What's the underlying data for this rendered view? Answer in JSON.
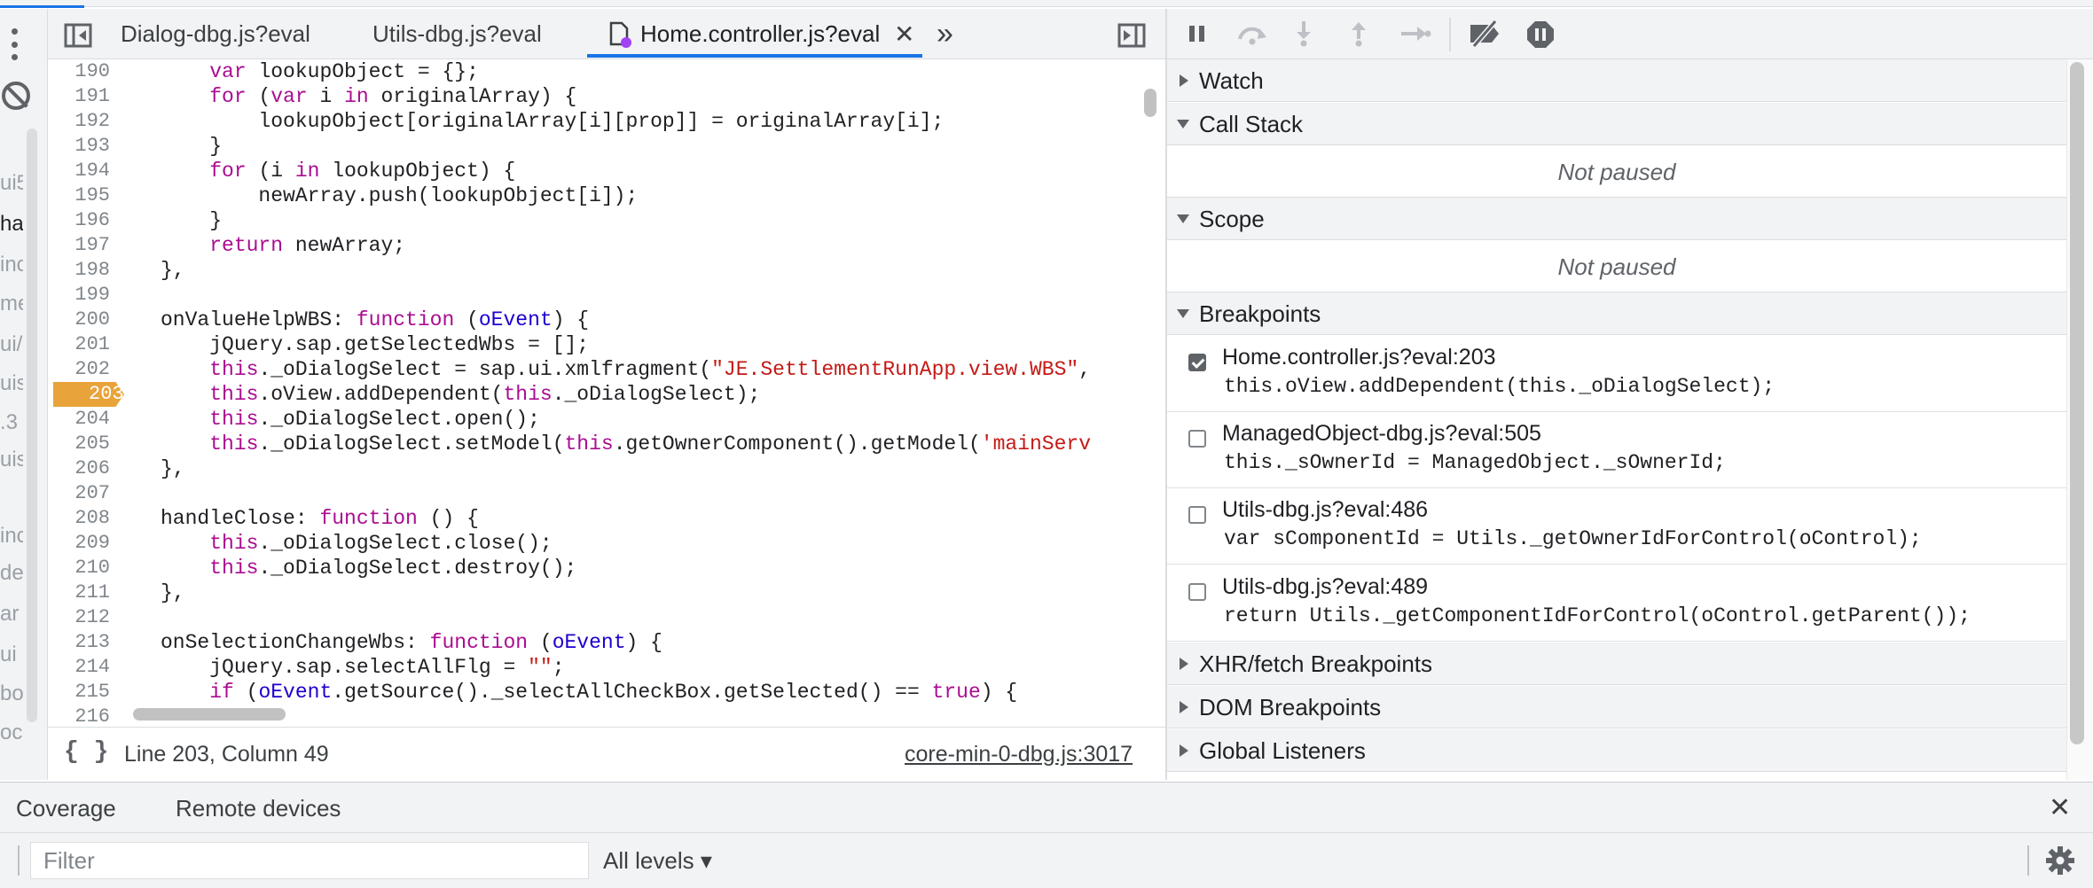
{
  "tabs": [
    {
      "label": "Dialog-dbg.js?eval",
      "active": false
    },
    {
      "label": "Utils-dbg.js?eval",
      "active": false
    },
    {
      "label": "Home.controller.js?eval",
      "active": true
    }
  ],
  "code": {
    "lines": [
      {
        "n": "190",
        "html": "    <span class=\"kw\">var</span> lookupObject = {};"
      },
      {
        "n": "191",
        "html": "    <span class=\"kw\">for</span> (<span class=\"kw\">var</span> i <span class=\"kw\">in</span> originalArray) {"
      },
      {
        "n": "192",
        "html": "        lookupObject[originalArray[i][prop]] = originalArray[i];"
      },
      {
        "n": "193",
        "html": "    }"
      },
      {
        "n": "194",
        "html": "    <span class=\"kw\">for</span> (i <span class=\"kw\">in</span> lookupObject) {"
      },
      {
        "n": "195",
        "html": "        newArray.push(lookupObject[i]);"
      },
      {
        "n": "196",
        "html": "    }"
      },
      {
        "n": "197",
        "html": "    <span class=\"kw\">return</span> newArray;"
      },
      {
        "n": "198",
        "html": "},"
      },
      {
        "n": "199",
        "html": ""
      },
      {
        "n": "200",
        "html": "onValueHelpWBS: <span class=\"kw\">function</span> (<span class=\"var\">oEvent</span>) {"
      },
      {
        "n": "201",
        "html": "    jQuery.sap.getSelectedWbs = [];"
      },
      {
        "n": "202",
        "html": "    <span class=\"kw\">this</span>._oDialogSelect = sap.ui.xmlfragment(<span class=\"str\">\"JE.SettlementRunApp.view.WBS\"</span>,"
      },
      {
        "n": "203",
        "html": "    <span class=\"kw\">this</span>.oView.addDependent(<span class=\"kw\">this</span>._oDialogSelect);"
      },
      {
        "n": "204",
        "html": "    <span class=\"kw\">this</span>._oDialogSelect.open();"
      },
      {
        "n": "205",
        "html": "    <span class=\"kw\">this</span>._oDialogSelect.setModel(<span class=\"kw\">this</span>.getOwnerComponent().getModel(<span class=\"str\">'mainServ</span>"
      },
      {
        "n": "206",
        "html": "},"
      },
      {
        "n": "207",
        "html": ""
      },
      {
        "n": "208",
        "html": "handleClose: <span class=\"kw\">function</span> () {"
      },
      {
        "n": "209",
        "html": "    <span class=\"kw\">this</span>._oDialogSelect.close();"
      },
      {
        "n": "210",
        "html": "    <span class=\"kw\">this</span>._oDialogSelect.destroy();"
      },
      {
        "n": "211",
        "html": "},"
      },
      {
        "n": "212",
        "html": ""
      },
      {
        "n": "213",
        "html": "onSelectionChangeWbs: <span class=\"kw\">function</span> (<span class=\"var\">oEvent</span>) {"
      },
      {
        "n": "214",
        "html": "    jQuery.sap.selectAllFlg = <span class=\"str\">\"\"</span>;"
      },
      {
        "n": "215",
        "html": "    <span class=\"kw\">if</span> (<span class=\"var\">oEvent</span>.getSource()._selectAllCheckBox.getSelected() == <span class=\"kw\">true</span>) {"
      },
      {
        "n": "216",
        "html": ""
      }
    ],
    "breakpoint_line": "203"
  },
  "navigator_fragments": [
    "ui5",
    "hai",
    "inc",
    "me",
    "ui/",
    "uis",
    ".3",
    "uis",
    "inc",
    "de",
    "ar",
    "ui",
    "bo",
    "oc"
  ],
  "status": {
    "pretty_print": "{ }",
    "position": "Line 203, Column 49",
    "source_link": "core-min-0-dbg.js:3017"
  },
  "sections": {
    "watch": "Watch",
    "call_stack": "Call Stack",
    "scope": "Scope",
    "breakpoints": "Breakpoints",
    "xhr": "XHR/fetch Breakpoints",
    "dom": "DOM Breakpoints",
    "global": "Global Listeners"
  },
  "not_paused": "Not paused",
  "breakpoints": [
    {
      "file": "Home.controller.js?eval:203",
      "code": "this.oView.addDependent(this._oDialogSelect);",
      "checked": true
    },
    {
      "file": "ManagedObject-dbg.js?eval:505",
      "code": "this._sOwnerId = ManagedObject._sOwnerId;",
      "checked": false
    },
    {
      "file": "Utils-dbg.js?eval:486",
      "code": "var sComponentId = Utils._getOwnerIdForControl(oControl);",
      "checked": false
    },
    {
      "file": "Utils-dbg.js?eval:489",
      "code": "return Utils._getComponentIdForControl(oControl.getParent());",
      "checked": false
    }
  ],
  "drawer": {
    "tabs": [
      "Coverage",
      "Remote devices"
    ],
    "filter_placeholder": "Filter",
    "levels": "All levels ▾"
  },
  "colors": {
    "accent": "#1a73e8",
    "breakpoint": "#e8a33a",
    "keyword": "#aa0d91",
    "string": "#c41a16"
  }
}
